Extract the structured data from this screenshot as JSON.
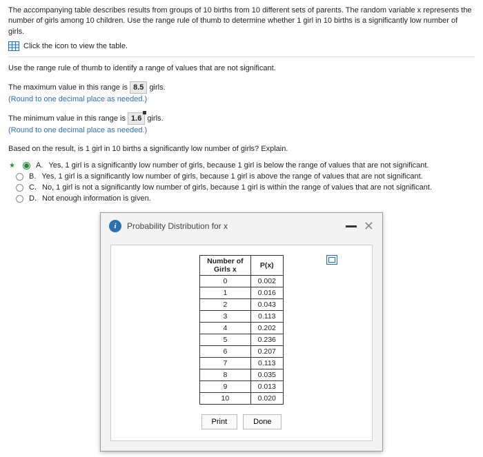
{
  "intro": {
    "text": "The accompanying table describes results from groups of 10 births from 10 different sets of parents. The random variable x represents the number of girls among 10 children. Use the range rule of thumb to determine whether 1 girl in 10 births is a significantly low number of girls.",
    "click_link": "Click the icon to view the table."
  },
  "prompt1": "Use the range rule of thumb to identify a range of values that are not significant.",
  "max_line": {
    "pre": "The maximum value in this range is ",
    "val": "8.5",
    "post": " girls."
  },
  "min_line": {
    "pre": "The minimum value in this range is ",
    "val": "1.6",
    "post": " girls."
  },
  "round_hint": "(Round to one decimal place as needed.)",
  "question": "Based on the result, is 1 girl in 10 births a significantly low number of girls? Explain.",
  "options": {
    "A": {
      "letter": "A.",
      "text": "Yes, 1 girl is a significantly low number of girls, because 1 girl is below the range of values that are not significant.",
      "selected": true
    },
    "B": {
      "letter": "B.",
      "text": "Yes, 1 girl is a significantly low number of girls, because 1 girl is above the range of values that are not significant.",
      "selected": false
    },
    "C": {
      "letter": "C.",
      "text": "No, 1 girl is not a significantly low number of girls, because 1 girl is within the range of values that are not significant.",
      "selected": false
    },
    "D": {
      "letter": "D.",
      "text": "Not enough information is given.",
      "selected": false
    }
  },
  "modal": {
    "title": "Probability Distribution for x",
    "col1_a": "Number of",
    "col1_b": "Girls x",
    "col2": "P(x)",
    "rows": [
      {
        "x": "0",
        "p": "0.002"
      },
      {
        "x": "1",
        "p": "0.016"
      },
      {
        "x": "2",
        "p": "0.043"
      },
      {
        "x": "3",
        "p": "0.113"
      },
      {
        "x": "4",
        "p": "0.202"
      },
      {
        "x": "5",
        "p": "0.236"
      },
      {
        "x": "6",
        "p": "0.207"
      },
      {
        "x": "7",
        "p": "0.113"
      },
      {
        "x": "8",
        "p": "0.035"
      },
      {
        "x": "9",
        "p": "0.013"
      },
      {
        "x": "10",
        "p": "0.020"
      }
    ],
    "print": "Print",
    "done": "Done"
  }
}
